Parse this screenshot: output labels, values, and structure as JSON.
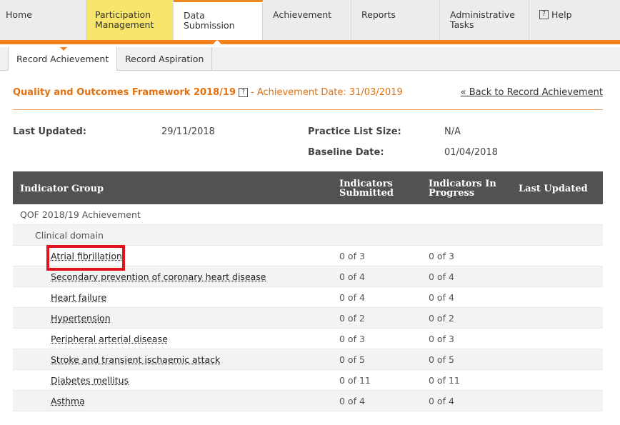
{
  "nav": {
    "tabs": [
      "Home",
      "Participation Management",
      "Data Submission",
      "Achievement",
      "Reports",
      "Administrative Tasks",
      "Help"
    ],
    "help_icon_glyph": "?"
  },
  "subnav": {
    "tabs": [
      "Record Achievement",
      "Record Aspiration"
    ]
  },
  "heading": {
    "title": "Quality and Outcomes Framework 2018/19",
    "help_glyph": "?",
    "achievement_date": "- Achievement Date: 31/03/2019",
    "back_link": "« Back to Record Achievement"
  },
  "meta": {
    "last_updated_label": "Last Updated:",
    "last_updated_value": "29/11/2018",
    "list_size_label": "Practice List Size:",
    "list_size_value": "N/A",
    "baseline_label": "Baseline Date:",
    "baseline_value": "01/04/2018"
  },
  "table": {
    "headers": [
      "Indicator Group",
      "Indicators Submitted",
      "Indicators In Progress",
      "Last Updated"
    ],
    "group": "QOF 2018/19 Achievement",
    "domain": "Clinical domain",
    "rows": [
      {
        "name": "Atrial fibrillation",
        "submitted": "0 of 3",
        "progress": "0 of 3"
      },
      {
        "name": "Secondary prevention of coronary heart disease",
        "submitted": "0 of 4",
        "progress": "0 of 4"
      },
      {
        "name": "Heart failure",
        "submitted": "0 of 4",
        "progress": "0 of 4"
      },
      {
        "name": "Hypertension",
        "submitted": "0 of 2",
        "progress": "0 of 2"
      },
      {
        "name": "Peripheral arterial disease",
        "submitted": "0 of 3",
        "progress": "0 of 3"
      },
      {
        "name": "Stroke and transient ischaemic attack",
        "submitted": "0 of 5",
        "progress": "0 of 5"
      },
      {
        "name": "Diabetes mellitus",
        "submitted": "0 of 11",
        "progress": "0 of 11"
      },
      {
        "name": "Asthma",
        "submitted": "0 of 4",
        "progress": "0 of 4"
      }
    ]
  },
  "colors": {
    "accent": "#f4821f",
    "highlight_tab": "#f7e56c",
    "header_bg": "#525252",
    "annotation": "#e0141e"
  }
}
